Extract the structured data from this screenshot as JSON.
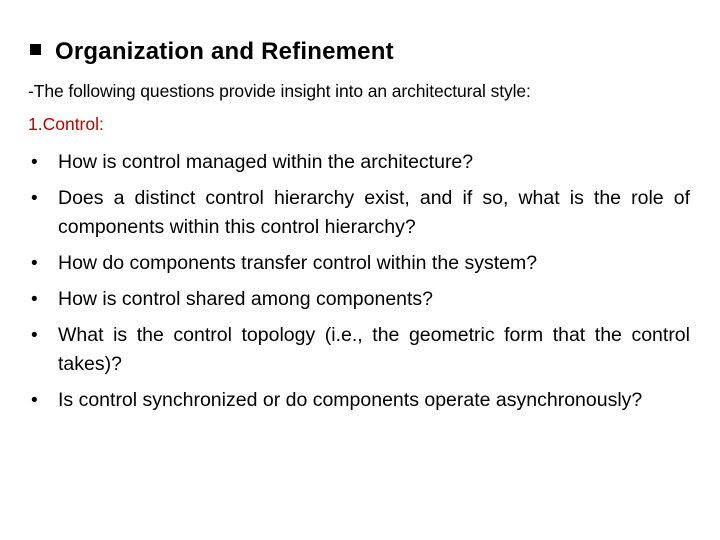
{
  "slide": {
    "heading": "Organization and Refinement",
    "intro": "-The following questions  provide insight into an architectural style:",
    "section_label": "1.Control:",
    "colors": {
      "text": "#000000",
      "section_label": "#c00000",
      "background": "#ffffff"
    },
    "bullet_glyph": "•",
    "heading_bullet_icon": "square-bullet-icon",
    "questions": [
      " How is control managed within the architecture?",
      "Does a distinct control hierarchy exist, and if so, what is the role of components within this control hierarchy?",
      "How do components transfer control within the system?",
      " How is control shared among components?",
      "What is the control topology (i.e., the geometric form that the control takes)?",
      "Is control synchronized or do components operate asynchronously?"
    ]
  }
}
